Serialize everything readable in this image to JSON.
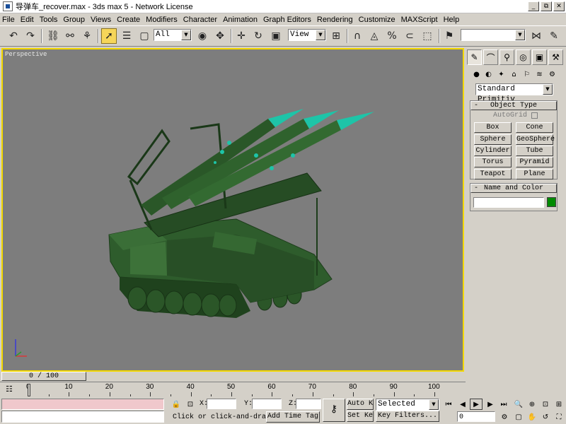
{
  "window": {
    "title": "导弹车_recover.max - 3ds max 5 - Network License",
    "buttons": [
      "_",
      "⧉",
      "✕"
    ]
  },
  "menu": [
    "File",
    "Edit",
    "Tools",
    "Group",
    "Views",
    "Create",
    "Modifiers",
    "Character",
    "Animation",
    "Graph Editors",
    "Rendering",
    "Customize",
    "MAXScript",
    "Help"
  ],
  "toolbar": {
    "selection_filter": "All",
    "reference_coord": "View",
    "named_selection": ""
  },
  "viewport": {
    "label": "Perspective",
    "border_color": "#f3d800",
    "background": "#7d7d7d",
    "model_color": "#2e5c2c",
    "missile_tip_color": "#1ec4a8"
  },
  "command_panel": {
    "category_dropdown": "Standard Primitiv",
    "object_type": {
      "header": "Object Type",
      "autogrid": "AutoGrid",
      "buttons": [
        "Box",
        "Cone",
        "Sphere",
        "GeoSphere",
        "Cylinder",
        "Tube",
        "Torus",
        "Pyramid",
        "Teapot",
        "Plane"
      ]
    },
    "name_and_color": {
      "header": "Name and Color",
      "name_value": "",
      "color_swatch": "#008a00"
    }
  },
  "time": {
    "slider_label": "0 / 100",
    "ticks": [
      "0",
      "10",
      "20",
      "30",
      "40",
      "50",
      "60",
      "70",
      "80",
      "90",
      "100"
    ]
  },
  "status": {
    "prompt": "Click or click-and-drag",
    "add_time_tag": "Add Time Tag",
    "x_label": "X:",
    "y_label": "Y:",
    "z_label": "Z:",
    "auto_key": "Auto Key",
    "set_key": "Set Key",
    "key_mode": "Selected",
    "key_filters": "Key Filters...",
    "current_frame": "0"
  }
}
